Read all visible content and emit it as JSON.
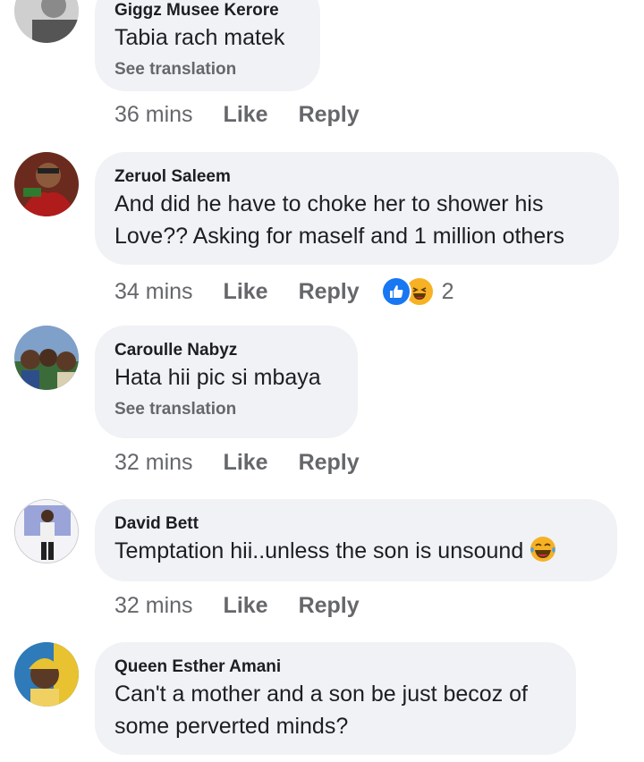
{
  "comments": [
    {
      "author": "Giggz Musee Kerore",
      "text": "Tabia rach matek",
      "see_translation": "See translation",
      "time": "36 mins",
      "like": "Like",
      "reply": "Reply"
    },
    {
      "author": "Zeruol Saleem",
      "text_line1": "And did he have to choke her to shower his",
      "text_line2": "Love?? Asking for maself and 1 million others",
      "time": "34 mins",
      "like": "Like",
      "reply": "Reply",
      "reaction_count": "2",
      "reaction_icons": [
        "like-icon",
        "haha-icon"
      ]
    },
    {
      "author": "Caroulle Nabyz",
      "text": "Hata hii pic si mbaya",
      "see_translation": "See translation",
      "time": "32 mins",
      "like": "Like",
      "reply": "Reply"
    },
    {
      "author": "David Bett",
      "text": "Temptation hii..unless the son is unsound",
      "emoji": "tears-of-joy-emoji",
      "time": "32 mins",
      "like": "Like",
      "reply": "Reply"
    },
    {
      "author": "Queen Esther Amani",
      "text_line1": "Can't a mother and a son be just becoz of",
      "text_line2": "some perverted minds?"
    }
  ],
  "colors": {
    "bubble": "#f0f2f5",
    "meta_text": "#65676b",
    "like_blue": "#1877f2",
    "haha_yellow": "#f7b125"
  }
}
